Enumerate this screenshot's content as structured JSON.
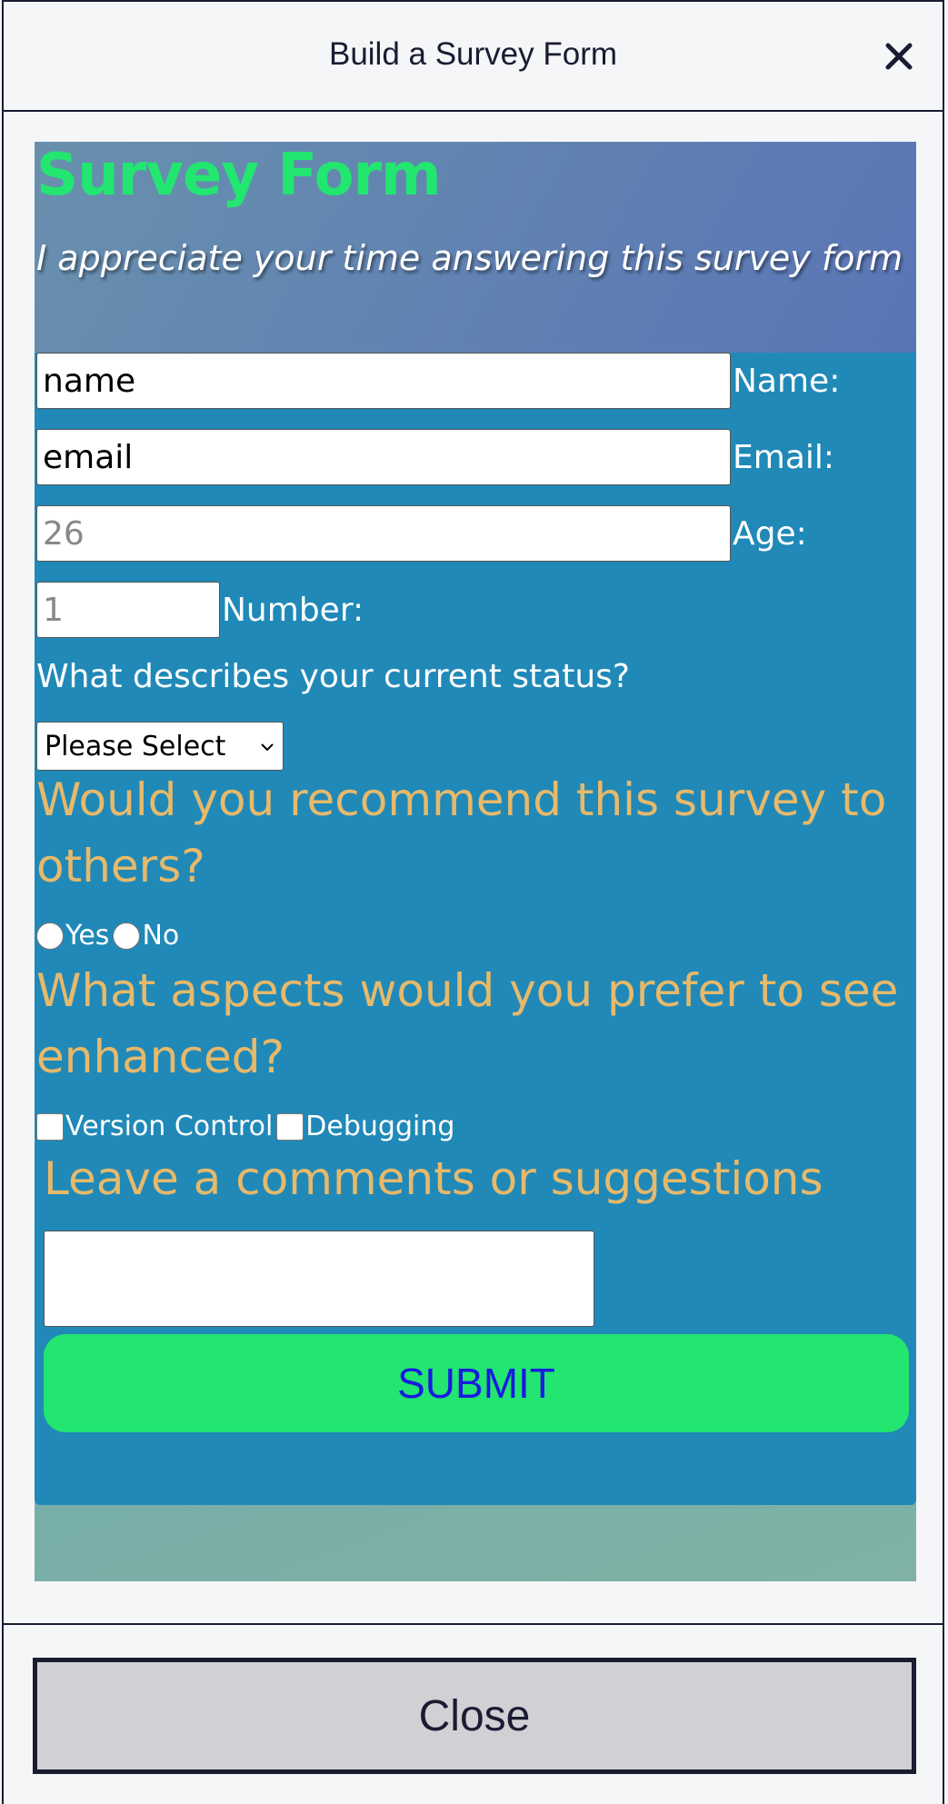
{
  "modal": {
    "title": "Build a Survey Form",
    "close_button": "Close"
  },
  "survey": {
    "title": "Survey Form",
    "description": "I appreciate your time answering this survey form",
    "fields": {
      "name": {
        "placeholder": "name",
        "label": "Name:"
      },
      "email": {
        "placeholder": "email",
        "label": "Email:"
      },
      "age": {
        "placeholder": "26",
        "label": "Age:"
      },
      "number": {
        "placeholder": "1",
        "label": "Number:"
      }
    },
    "status_question": "What describes your current status?",
    "status_select": "Please Select",
    "recommend_question": "Would you recommend this survey to others?",
    "recommend_options": [
      "Yes",
      "No"
    ],
    "enhance_question": "What aspects would you prefer to see enhanced?",
    "enhance_options": [
      "Version Control",
      "Debugging"
    ],
    "comments_heading": "Leave a comments or suggestions",
    "submit_label": "SUBMIT"
  },
  "colors": {
    "title_green": "#22e670",
    "heading_gold": "#e6b96b",
    "form_blue": "#2089b8",
    "submit_text": "#1a1ae0"
  }
}
